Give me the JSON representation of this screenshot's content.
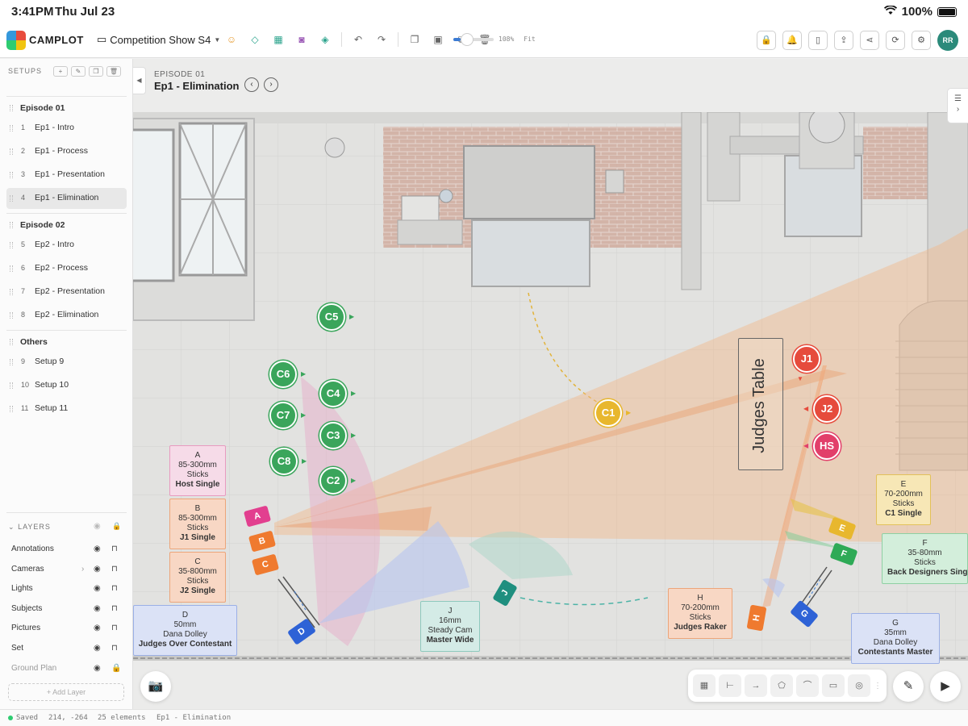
{
  "status": {
    "time": "3:41PM",
    "date": "Thu Jul 23",
    "battery": "100%"
  },
  "toolbar": {
    "brand": "CAMPLOT",
    "project": "Competition Show S4",
    "zoom_label": "108%",
    "zoom_level": 0.18,
    "fit_label": "Fit",
    "avatar_initials": "RR"
  },
  "sidebar": {
    "setups_title": "SETUPS",
    "groups": [
      {
        "title": "Episode 01",
        "items": [
          {
            "num": "1",
            "label": "Ep1 - Intro"
          },
          {
            "num": "2",
            "label": "Ep1 - Process"
          },
          {
            "num": "3",
            "label": "Ep1 - Presentation"
          },
          {
            "num": "4",
            "label": "Ep1 - Elimination",
            "active": true
          }
        ]
      },
      {
        "title": "Episode 02",
        "items": [
          {
            "num": "5",
            "label": "Ep2 - Intro"
          },
          {
            "num": "6",
            "label": "Ep2 - Process"
          },
          {
            "num": "7",
            "label": "Ep2 - Presentation"
          },
          {
            "num": "8",
            "label": "Ep2 - Elimination"
          }
        ]
      },
      {
        "title": "Others",
        "items": [
          {
            "num": "9",
            "label": "Setup 9"
          },
          {
            "num": "10",
            "label": "Setup 10"
          },
          {
            "num": "11",
            "label": "Setup 11"
          }
        ]
      }
    ],
    "layers_title": "LAYERS",
    "layers": [
      "Annotations",
      "Cameras",
      "Lights",
      "Subjects",
      "Pictures",
      "Set",
      "Ground Plan"
    ],
    "add_layer": "+ Add Layer"
  },
  "canvas": {
    "episode_tag": "EPISODE 01",
    "episode_title": "Ep1 - Elimination",
    "judges_table": "Judges Table",
    "subjects": [
      "C5",
      "C6",
      "C4",
      "C7",
      "C3",
      "C8",
      "C2",
      "C1",
      "J1",
      "J2",
      "HS"
    ],
    "cameras": [
      {
        "id": "A",
        "lens": "85-300mm",
        "support": "Sticks",
        "shot": "Host Single"
      },
      {
        "id": "B",
        "lens": "85-300mm",
        "support": "Sticks",
        "shot": "J1 Single"
      },
      {
        "id": "C",
        "lens": "35-800mm",
        "support": "Sticks",
        "shot": "J2 Single"
      },
      {
        "id": "D",
        "lens": "50mm",
        "support": "Dana Dolley",
        "shot": "Judges Over Contestant"
      },
      {
        "id": "J",
        "lens": "16mm",
        "support": "Steady Cam",
        "shot": "Master Wide"
      },
      {
        "id": "H",
        "lens": "70-200mm",
        "support": "Sticks",
        "shot": "Judges Raker"
      },
      {
        "id": "E",
        "lens": "70-200mm",
        "support": "Sticks",
        "shot": "C1 Single"
      },
      {
        "id": "F",
        "lens": "35-80mm",
        "support": "Sticks",
        "shot": "Back Designers Single"
      },
      {
        "id": "G",
        "lens": "35mm",
        "support": "Dana Dolley",
        "shot": "Contestants Master"
      }
    ]
  },
  "footer": {
    "saved": "Saved",
    "coords": "214, -264",
    "elements": "25 elements",
    "setup": "Ep1 - Elimination"
  }
}
